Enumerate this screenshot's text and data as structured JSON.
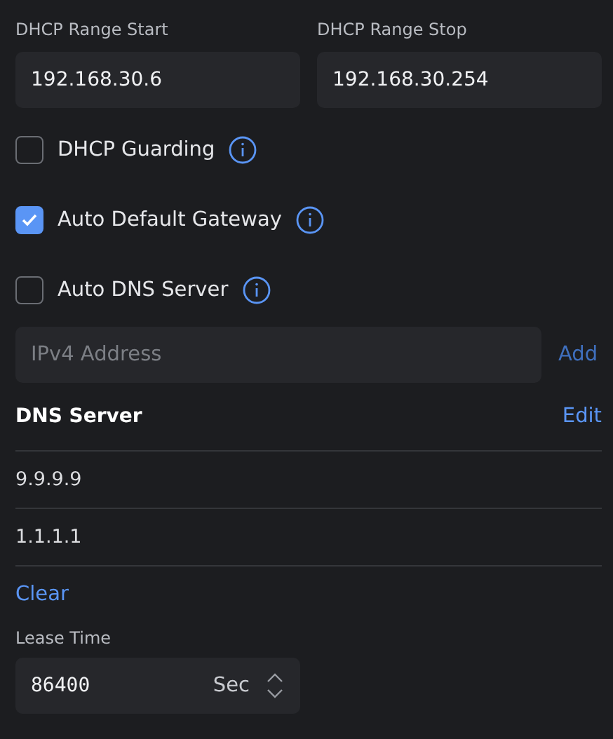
{
  "range_fields": [
    {
      "label": "DHCP Range Start",
      "value": "192.168.30.6"
    },
    {
      "label": "DHCP Range Stop",
      "value": "192.168.30.254"
    }
  ],
  "options": [
    {
      "label": "DHCP Guarding",
      "checked": false
    },
    {
      "label": "Auto Default Gateway",
      "checked": true
    },
    {
      "label": "Auto DNS Server",
      "checked": false
    }
  ],
  "dns_input": {
    "placeholder": "IPv4 Address",
    "add": "Add",
    "add_disabled": true
  },
  "dns_list": {
    "title": "DNS Server",
    "edit": "Edit",
    "items": [
      "9.9.9.9",
      "1.1.1.1"
    ],
    "clear": "Clear"
  },
  "lease": {
    "label": "Lease Time",
    "value": "86400",
    "unit": "Sec"
  }
}
